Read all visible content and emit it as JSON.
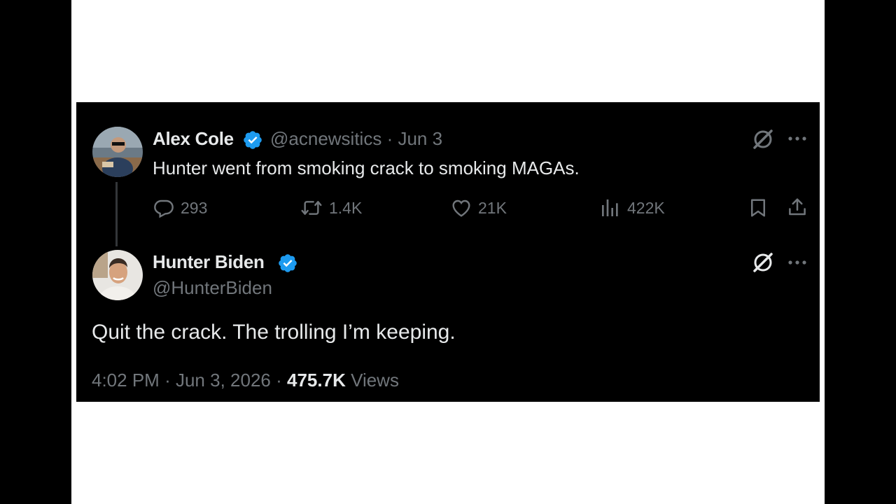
{
  "colors": {
    "background": "#000000",
    "frame": "#ffffff",
    "text_primary": "#e7e9ea",
    "text_secondary": "#71767b",
    "verified_blue": "#1d9bf0",
    "thread_line": "#333639"
  },
  "reply_to": {
    "author_name": "Alex Cole",
    "handle": "@acnewsitics",
    "separator": "·",
    "date": "Jun 3",
    "text": "Hunter went from smoking crack to smoking MAGAs.",
    "verified_icon": "verified-badge-icon",
    "grok_icon": "grok-icon",
    "more_icon": "more-icon",
    "stats": {
      "replies": "293",
      "reposts": "1.4K",
      "likes": "21K",
      "views": "422K"
    }
  },
  "main_tweet": {
    "author_name": "Hunter Biden",
    "handle": "@HunterBiden",
    "text": "Quit the crack. The trolling I’m keeping.",
    "time": "4:02 PM",
    "separator": "·",
    "date": "Jun 3, 2026",
    "views_count": "475.7K",
    "views_label": "Views"
  }
}
